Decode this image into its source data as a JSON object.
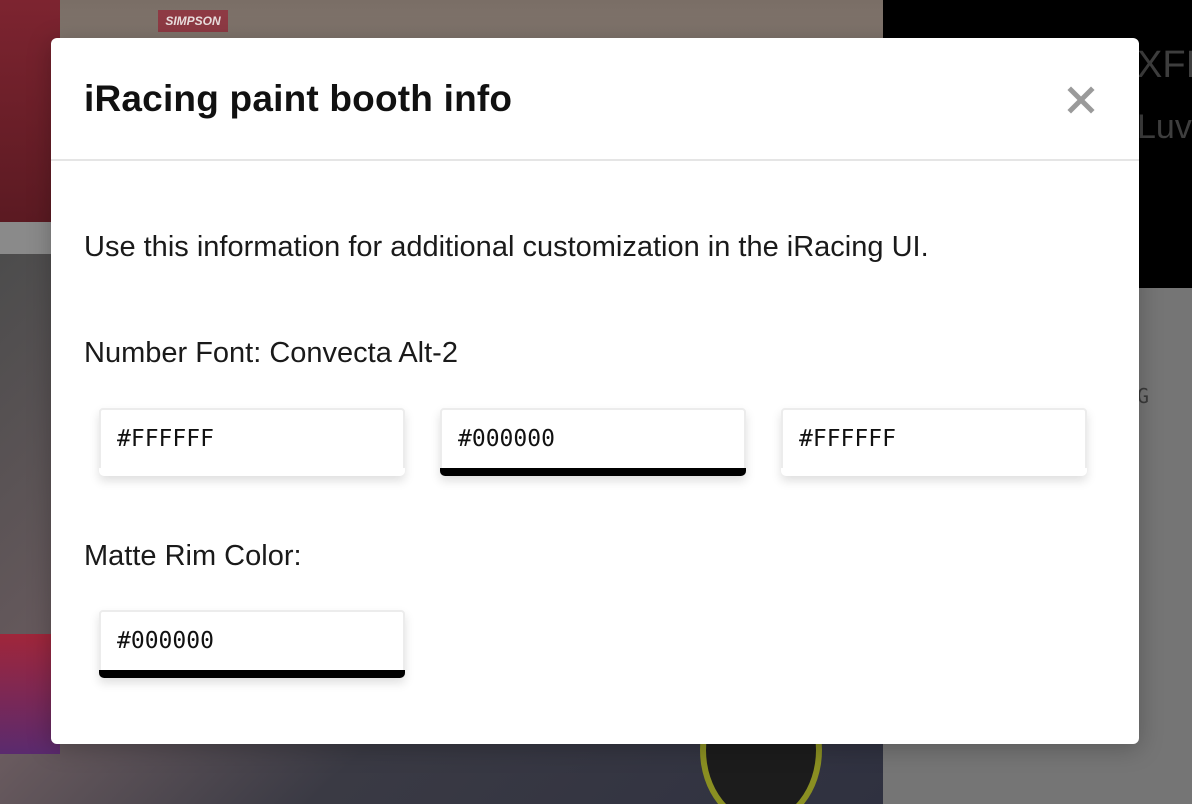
{
  "background": {
    "sponsor_text": "SIMPSON",
    "right_text_1": "XFI",
    "right_text_2": "Luv",
    "right_text_3": "G"
  },
  "modal": {
    "title": "iRacing paint booth info",
    "close_label": "×",
    "intro": "Use this information for additional customization in the iRacing UI.",
    "number_font": {
      "label": "Number Font: Convecta Alt-2",
      "colors": [
        {
          "value": "#FFFFFF",
          "swatch": "#FFFFFF"
        },
        {
          "value": "#000000",
          "swatch": "#000000"
        },
        {
          "value": "#FFFFFF",
          "swatch": "#FFFFFF"
        }
      ]
    },
    "matte_rim": {
      "label": "Matte Rim Color:",
      "colors": [
        {
          "value": "#000000",
          "swatch": "#000000"
        }
      ]
    }
  }
}
